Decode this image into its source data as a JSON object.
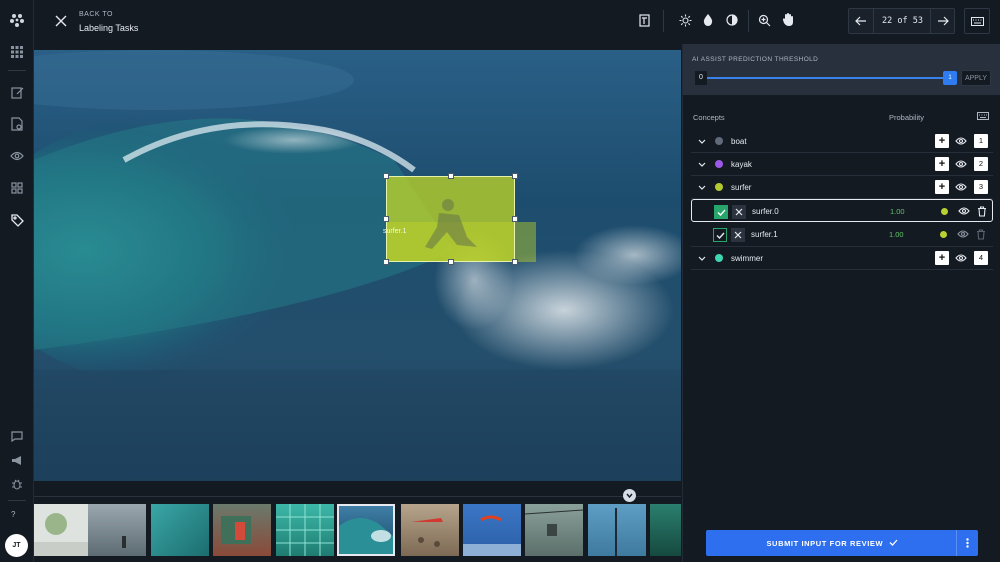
{
  "header": {
    "back_small": "BACK TO",
    "back_title": "Labeling Tasks",
    "counter": "22 of 53"
  },
  "canvas": {
    "box_label": "surfer.1"
  },
  "panel": {
    "threshold_label": "AI ASSIST PREDICTION THRESHOLD",
    "slider_min": "0",
    "slider_value": "1",
    "apply_label": "APPLY",
    "col_concepts": "Concepts",
    "col_probability": "Probability",
    "concepts": [
      {
        "name": "boat",
        "color": "#5f6b78",
        "hotkey": "1"
      },
      {
        "name": "kayak",
        "color": "#9b59e6",
        "hotkey": "2"
      },
      {
        "name": "surfer",
        "color": "#b4c832",
        "hotkey": "3"
      },
      {
        "name": "swimmer",
        "color": "#3fd6b2",
        "hotkey": "4"
      }
    ],
    "annotations": [
      {
        "name": "surfer.0",
        "prob": "1.00"
      },
      {
        "name": "surfer.1",
        "prob": "1.00"
      }
    ],
    "submit_label": "SUBMIT INPUT FOR REVIEW"
  },
  "sidebar": {
    "avatar_initials": "JT",
    "help": "?"
  },
  "thumbnails": [
    {
      "name": "thumb-1"
    },
    {
      "name": "thumb-2"
    },
    {
      "name": "thumb-3"
    },
    {
      "name": "thumb-4"
    },
    {
      "name": "thumb-5"
    },
    {
      "name": "thumb-6-active"
    },
    {
      "name": "thumb-7"
    },
    {
      "name": "thumb-8"
    },
    {
      "name": "thumb-9"
    },
    {
      "name": "thumb-10"
    },
    {
      "name": "thumb-11"
    }
  ],
  "icons": [
    "logo-icon",
    "grid-icon",
    "edit-icon",
    "document-icon",
    "eye-icon",
    "apps-icon",
    "tag-icon",
    "chat-icon",
    "megaphone-icon",
    "bug-icon",
    "close-icon",
    "filter-icon",
    "brightness-icon",
    "contrast-icon",
    "saturation-icon",
    "zoom-icon",
    "hand-icon",
    "arrow-left-icon",
    "arrow-right-icon",
    "keyboard-icon"
  ]
}
